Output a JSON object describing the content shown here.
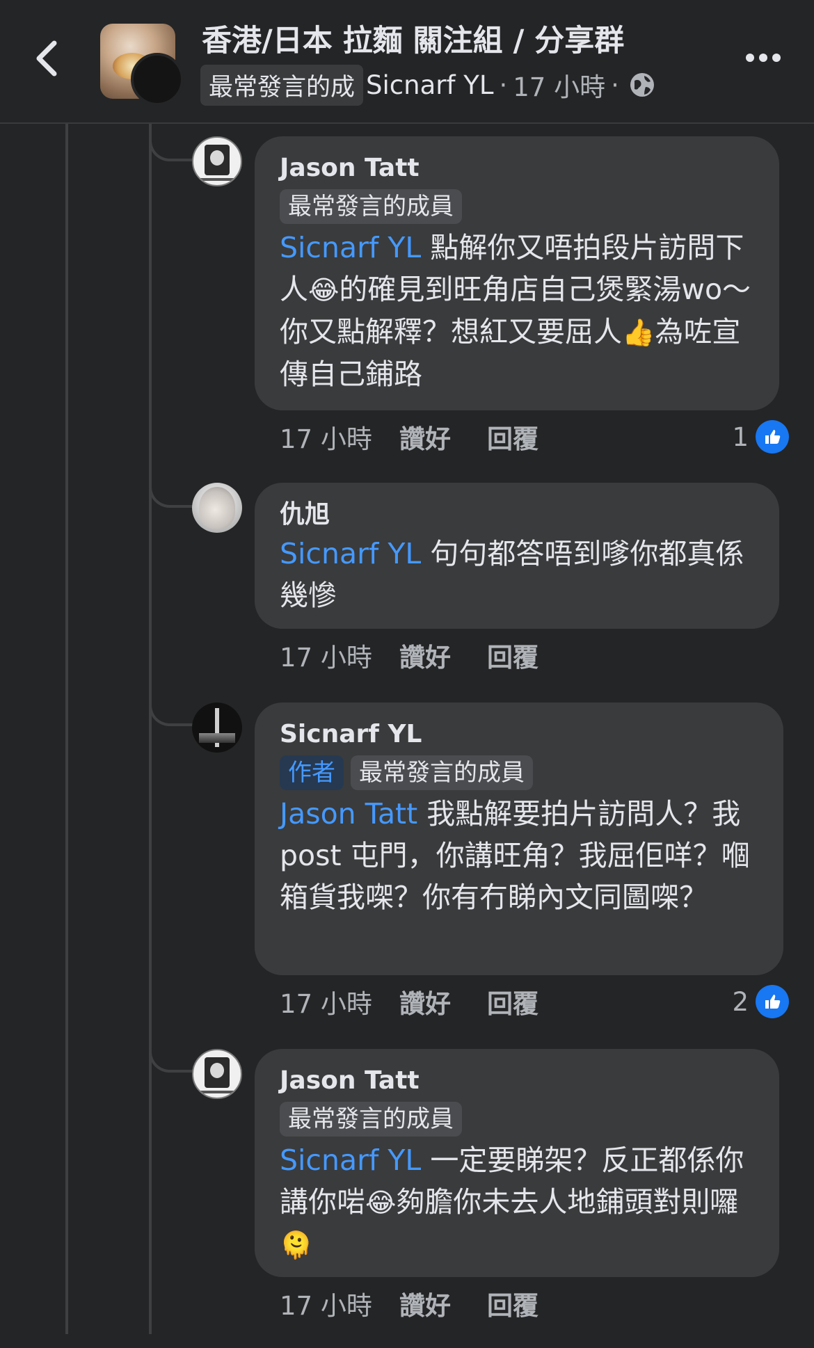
{
  "header": {
    "group_title": "香港/日本 拉麵 關注組 / 分享群",
    "badge": "最常發言的成",
    "poster_name": "Sicnarf YL",
    "separator": "·",
    "time": "17 小時",
    "separator2": "·",
    "icons": {
      "back": "chevron-left-icon",
      "privacy": "globe-icon",
      "more": "more-dots-icon"
    }
  },
  "actions": {
    "like": "讚好",
    "reply": "回覆"
  },
  "comments": [
    {
      "author": "Jason Tatt",
      "badges": [
        "最常發言的成員"
      ],
      "mention": "Sicnarf YL",
      "text_1": " 點解你又唔拍段片訪問下人",
      "emoji_1": "😂",
      "text_2": "的確見到旺角店自己煲緊湯wo～你又點解釋？想紅又要屈人",
      "emoji_2": "👍",
      "text_3": "為咗宣傳自己鋪路",
      "time": "17 小時",
      "likes": "1"
    },
    {
      "author": "仇旭",
      "mention": "Sicnarf YL",
      "text_1": " 句句都答唔到嗲你都真係幾慘",
      "time": "17 小時"
    },
    {
      "author": "Sicnarf YL",
      "author_tag": "作者",
      "badges": [
        "最常發言的成員"
      ],
      "mention": "Jason Tatt",
      "text_1": " 我點解要拍片訪問人？我 post 屯門，你講旺角？我屈佢咩？嗰箱貨我㗎？你有冇睇內文同圖㗎？",
      "time": "17 小時",
      "likes": "2"
    },
    {
      "author": "Jason Tatt",
      "badges": [
        "最常發言的成員"
      ],
      "mention": "Sicnarf YL",
      "text_1": " 一定要睇架？反正都係你講你啱",
      "emoji_1": "😂",
      "text_2": "夠膽你未去人地鋪頭對則囉",
      "emoji_2": "🫠",
      "time": "17 小時"
    }
  ]
}
